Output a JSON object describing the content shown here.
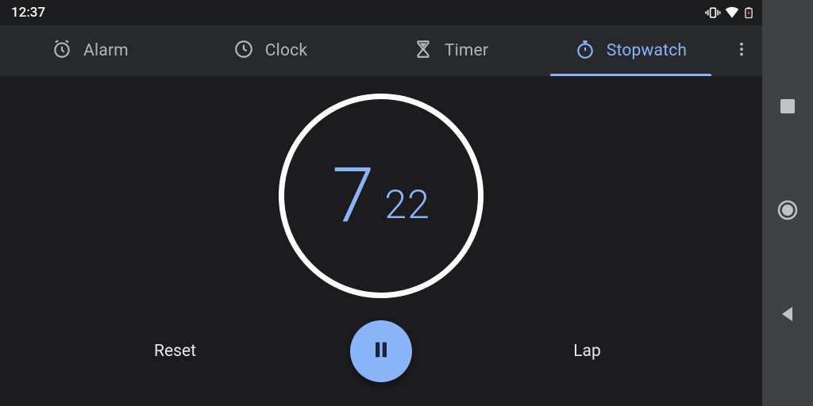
{
  "status": {
    "time": "12:37"
  },
  "tabs": {
    "alarm": {
      "label": "Alarm"
    },
    "clock": {
      "label": "Clock"
    },
    "timer": {
      "label": "Timer"
    },
    "stopwatch": {
      "label": "Stopwatch"
    }
  },
  "active_tab": "stopwatch",
  "stopwatch": {
    "seconds": "7",
    "hundredths": "22",
    "reset_label": "Reset",
    "lap_label": "Lap"
  },
  "colors": {
    "accent": "#8ab4f8",
    "app_bar": "#28292c",
    "background": "#1c1c1e",
    "nav_rail": "#3f4244"
  }
}
